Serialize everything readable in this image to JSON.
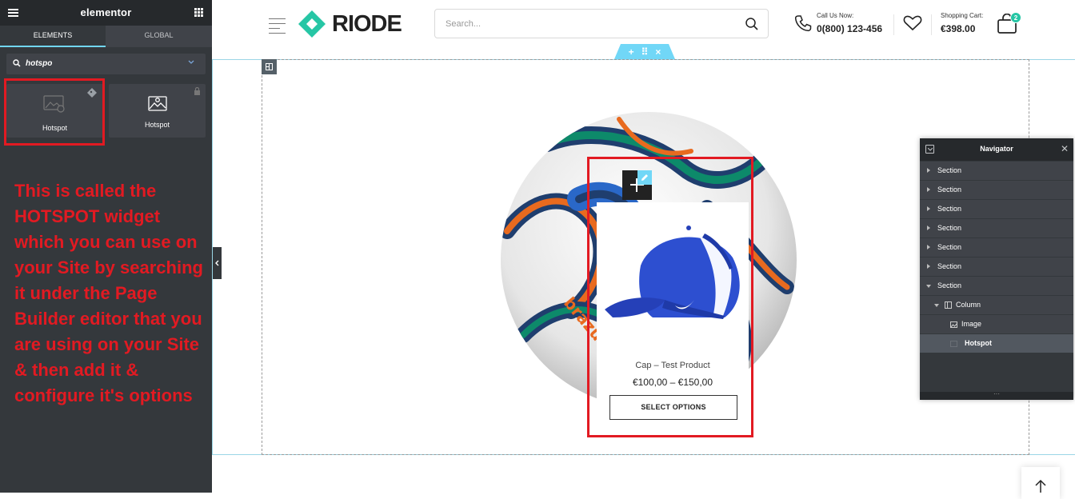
{
  "editor": {
    "brand": "elementor",
    "tabs": [
      "ELEMENTS",
      "GLOBAL"
    ],
    "search_value": "hotspo",
    "widgets": [
      {
        "label": "Hotspot"
      },
      {
        "label": "Hotspot"
      }
    ],
    "annotation": "This is called the HOTSPOT widget which you can use on your Site by searching it under the Page Builder editor that you are using on your Site & then add it & configure it's options"
  },
  "site": {
    "logo_text": "RIODE",
    "search_placeholder": "Search...",
    "call_label": "Call Us Now:",
    "call_number": "0(800) 123-456",
    "cart_label": "Shopping Cart:",
    "cart_total": "€398.00",
    "cart_count": "2",
    "accent_color": "#26c6a5"
  },
  "section_controls": {
    "add": "+",
    "move": "⠿",
    "delete": "×"
  },
  "hotspot_popup": {
    "product_name": "Cap – Test Product",
    "price": "€100,00 – €150,00",
    "button_label": "SELECT OPTIONS"
  },
  "navigator": {
    "title": "Navigator",
    "items": [
      {
        "label": "Section"
      },
      {
        "label": "Section"
      },
      {
        "label": "Section"
      },
      {
        "label": "Section"
      },
      {
        "label": "Section"
      },
      {
        "label": "Section"
      },
      {
        "label": "Section"
      },
      {
        "label": "Column"
      },
      {
        "label": "Image"
      },
      {
        "label": "Hotspot"
      }
    ]
  },
  "annotation_color": "#e21a22"
}
